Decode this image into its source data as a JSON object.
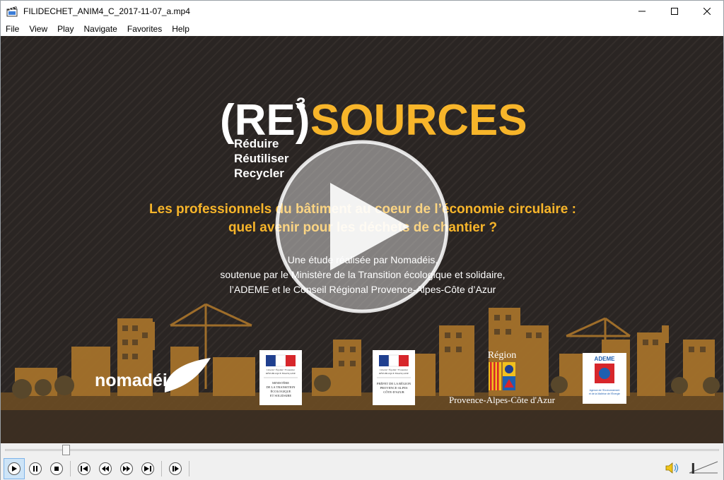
{
  "window": {
    "title": "FILIDECHET_ANIM4_C_2017-11-07_a.mp4",
    "icon": "film-clapper-icon"
  },
  "menu": {
    "items": [
      {
        "label": "File"
      },
      {
        "label": "View"
      },
      {
        "label": "Play"
      },
      {
        "label": "Navigate"
      },
      {
        "label": "Favorites"
      },
      {
        "label": "Help"
      }
    ]
  },
  "video": {
    "brand_prefix": "(RE)",
    "brand_superscript": "3",
    "brand_main": "SOURCES",
    "brand_sub": [
      "Réduire",
      "Réutiliser",
      "Recycler"
    ],
    "headline": [
      "Les professionnels du bâtiment au coeur de l’économie circulaire :",
      "quel avenir pour les déchets de chantier ?"
    ],
    "credits": [
      "Une étude réalisée par Nomadéis,",
      "soutenue par le Ministère de la Transition écologique et solidaire,",
      "l’ADEME et le Conseil Régional Provence-Alpes-Côte d’Azur"
    ],
    "logos": {
      "nomadeis": "nomadéis",
      "ministry": {
        "motto": "Liberté • Égalité • Fraternité",
        "republic": "RÉPUBLIQUE FRANÇAISE",
        "lines": [
          "MINISTÈRE",
          "DE LA TRANSITION",
          "ÉCOLOGIQUE",
          "ET SOLIDAIRE"
        ]
      },
      "prefet": {
        "motto": "Liberté • Égalité • Fraternité",
        "republic": "RÉPUBLIQUE FRANÇAISE",
        "lines": [
          "PRÉFET DE LA RÉGION",
          "PROVENCE-ALPES",
          "CÔTE-D'AZUR"
        ]
      },
      "region": {
        "top": "Région",
        "bottom": "Provence-Alpes-Côte d'Azur"
      },
      "ademe": {
        "name": "ADEME",
        "lines": [
          "Agence de l'Environnement",
          "et de la Maîtrise de l'Énergie"
        ]
      }
    },
    "colors": {
      "accent": "#f7b52a",
      "background": "#2a2523",
      "city": "#b07a2c"
    }
  },
  "playback": {
    "progress": 0.08
  },
  "controls": {
    "buttons": [
      {
        "name": "play-button",
        "icon": "play-icon"
      },
      {
        "name": "pause-button",
        "icon": "pause-icon"
      },
      {
        "name": "stop-button",
        "icon": "stop-icon"
      },
      {
        "name": "skip-back-button",
        "icon": "skip-back-icon"
      },
      {
        "name": "rewind-button",
        "icon": "rewind-icon"
      },
      {
        "name": "fast-forward-button",
        "icon": "fast-forward-icon"
      },
      {
        "name": "skip-forward-button",
        "icon": "skip-forward-icon"
      },
      {
        "name": "frame-step-button",
        "icon": "frame-step-icon"
      }
    ],
    "volume": 0.1
  }
}
